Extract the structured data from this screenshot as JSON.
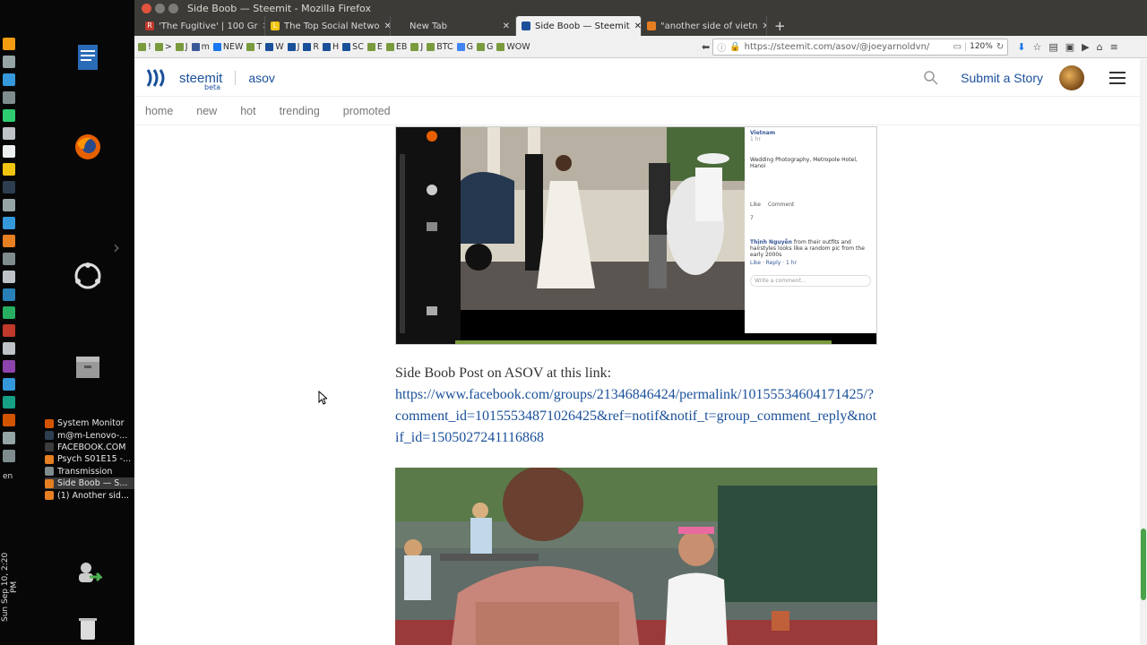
{
  "window": {
    "title": "Side Boob — Steemit - Mozilla Firefox"
  },
  "tabs": [
    {
      "label": "'The Fugitive' | 100 Gr",
      "favicon_color": "#c0392b",
      "favicon_letter": "R",
      "active": false
    },
    {
      "label": "The Top Social Netwo",
      "favicon_color": "#f1c40f",
      "favicon_letter": "L",
      "active": false
    },
    {
      "label": "New Tab",
      "favicon_color": "#3c3b37",
      "favicon_letter": "",
      "active": false
    },
    {
      "label": "Side Boob — Steemit",
      "favicon_color": "#1a5099",
      "favicon_letter": "",
      "active": true
    },
    {
      "label": "\"another side of vietn",
      "favicon_color": "#e67e22",
      "favicon_letter": "",
      "active": false
    }
  ],
  "bookmarks": [
    "!",
    ">",
    "J",
    "m",
    "NEW",
    "T",
    "W",
    "J",
    "R",
    "H",
    "SC",
    "E",
    "EB",
    "J",
    "BTC",
    "G",
    "G",
    "WOW"
  ],
  "urlbar": {
    "url": "https://steemit.com/asov/@joeyarnoldvn/",
    "zoom": "120%"
  },
  "site": {
    "brand": "steemit",
    "beta": "beta",
    "tag": "asov",
    "submit": "Submit a Story",
    "nav": [
      "home",
      "new",
      "hot",
      "trending",
      "promoted"
    ]
  },
  "post": {
    "fb": {
      "name": "Vietnam",
      "time": "1 hr",
      "caption": "Wedding Photography, Metropole Hotel, Hanoi",
      "like": "Like",
      "comment": "Comment",
      "reactions": "7",
      "commenter": "Thịnh Nguyễn",
      "comment_text": "from their outfits and hairstyles looks like a random pic from the early 2000s",
      "reply": "Like · Reply · 1 hr",
      "write": "Write a comment..."
    },
    "text": "Side Boob Post on ASOV at this link:",
    "link": "https://www.facebook.com/groups/21346846424/permalink/10155534604171425/?comment_id=10155534871026425&ref=notif&notif_t=group_comment_reply&notif_id=1505027241116868"
  },
  "desktop": {
    "clock": "Sun Sep 10, 2:20 PM",
    "lang": "en",
    "taskbar": [
      {
        "label": "System Monitor",
        "color": "#d35400",
        "active": false
      },
      {
        "label": "m@m-Lenovo-...",
        "color": "#2c3e50",
        "active": false
      },
      {
        "label": "FACEBOOK.COM",
        "color": "#3c3c3c",
        "active": false
      },
      {
        "label": "Psych S01E15 -...",
        "color": "#e67e22",
        "active": false
      },
      {
        "label": "Transmission",
        "color": "#7f8c8d",
        "active": false
      },
      {
        "label": "Side Boob — S...",
        "color": "#e67e22",
        "active": true
      },
      {
        "label": "(1) Another sid...",
        "color": "#e67e22",
        "active": false
      }
    ]
  },
  "colors": {
    "steemit_blue": "#1a5099",
    "scroll_green": "#4aa24a"
  }
}
